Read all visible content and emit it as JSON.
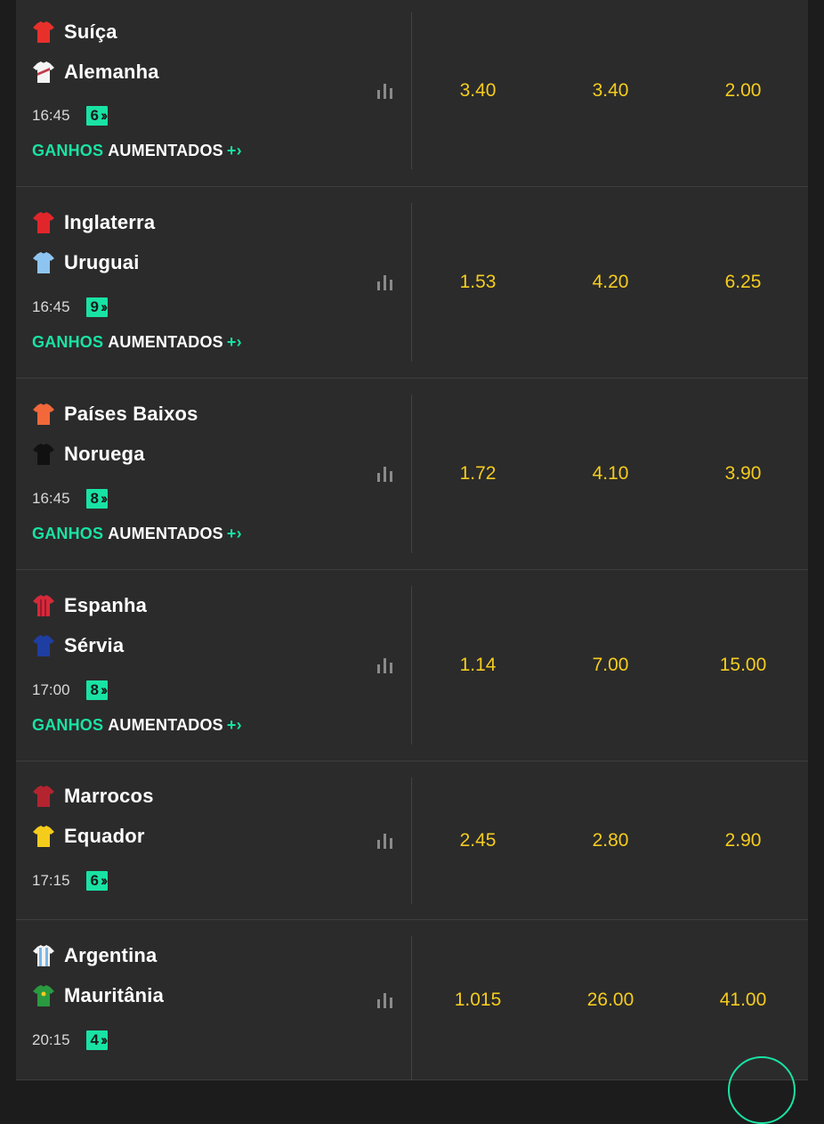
{
  "labels": {
    "ganhos": "GANHOS",
    "aumentados": "AUMENTADOS"
  },
  "colors": {
    "accent": "#19e3a4",
    "odds": "#f5cc1f",
    "row_bg": "#2b2b2b",
    "page_bg": "#1c1c1c"
  },
  "matches": [
    {
      "home": "Suíça",
      "away": "Alemanha",
      "time": "16:45",
      "markets": "6",
      "boosted": true,
      "odds": [
        "3.40",
        "3.40",
        "2.00"
      ],
      "home_kit": [
        "#e8302b",
        "#e8302b"
      ],
      "away_kit": [
        "#f4f4f4",
        "#c23b4a"
      ]
    },
    {
      "home": "Inglaterra",
      "away": "Uruguai",
      "time": "16:45",
      "markets": "9",
      "boosted": true,
      "odds": [
        "1.53",
        "4.20",
        "6.25"
      ],
      "home_kit": [
        "#e0262b",
        "#e0262b"
      ],
      "away_kit": [
        "#8ec5f0",
        "#8ec5f0"
      ]
    },
    {
      "home": "Países Baixos",
      "away": "Noruega",
      "time": "16:45",
      "markets": "8",
      "boosted": true,
      "odds": [
        "1.72",
        "4.10",
        "3.90"
      ],
      "home_kit": [
        "#f2683a",
        "#f2683a"
      ],
      "away_kit": [
        "#111111",
        "#111111"
      ]
    },
    {
      "home": "Espanha",
      "away": "Sérvia",
      "time": "17:00",
      "markets": "8",
      "boosted": true,
      "odds": [
        "1.14",
        "7.00",
        "15.00"
      ],
      "home_kit": [
        "#d52a3a",
        "#9b1a2c"
      ],
      "away_kit": [
        "#1f3ea1",
        "#1f3ea1"
      ]
    },
    {
      "home": "Marrocos",
      "away": "Equador",
      "time": "17:15",
      "markets": "6",
      "boosted": false,
      "odds": [
        "2.45",
        "2.80",
        "2.90"
      ],
      "home_kit": [
        "#b3242f",
        "#b3242f"
      ],
      "away_kit": [
        "#f6cc1c",
        "#f6cc1c"
      ]
    },
    {
      "home": "Argentina",
      "away": "Mauritânia",
      "time": "20:15",
      "markets": "4",
      "boosted": false,
      "odds": [
        "1.015",
        "26.00",
        "41.00"
      ],
      "home_kit": [
        "#f4f4f4",
        "#79b7e8"
      ],
      "away_kit": [
        "#2a9a40",
        "#2a9a40"
      ]
    }
  ]
}
